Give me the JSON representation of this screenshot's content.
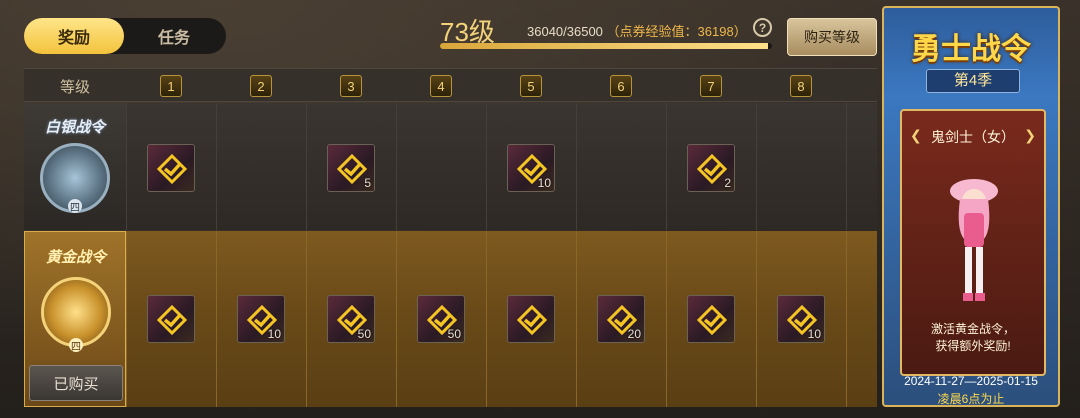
{
  "tabs": [
    {
      "label": "奖励",
      "active": true
    },
    {
      "label": "任务",
      "active": false
    }
  ],
  "header": {
    "level_label": "73级",
    "exp": "36040/36500",
    "points_label": "（点券经验值：36198）",
    "exp_progress": 0.987,
    "help_glyph": "?",
    "buy_level_label": "购买等级"
  },
  "table": {
    "level_header": "等级",
    "levels": [
      "1",
      "2",
      "3",
      "4",
      "5",
      "6",
      "7",
      "8"
    ],
    "silver": {
      "title": "白银战令",
      "emblem_num": "四",
      "rewards": [
        {
          "col": 0,
          "count": ""
        },
        {
          "col": 2,
          "count": "5"
        },
        {
          "col": 4,
          "count": "10"
        },
        {
          "col": 6,
          "count": "2"
        }
      ]
    },
    "gold": {
      "title": "黄金战令",
      "emblem_num": "四",
      "bought_label": "已购买",
      "rewards": [
        {
          "col": 0,
          "count": ""
        },
        {
          "col": 1,
          "count": "10"
        },
        {
          "col": 2,
          "count": "50"
        },
        {
          "col": 3,
          "count": "50"
        },
        {
          "col": 4,
          "count": ""
        },
        {
          "col": 5,
          "count": "20"
        },
        {
          "col": 6,
          "count": ""
        },
        {
          "col": 7,
          "count": "10"
        }
      ]
    }
  },
  "promo": {
    "title": "勇士战令",
    "season": "第4季",
    "character": "鬼剑士（女）",
    "note_line1": "激活黄金战令，",
    "note_line2": "获得额外奖励!",
    "dates": "2024-11-27—2025-01-15",
    "dates_sub": "凌晨6点为止"
  },
  "colors": {
    "accent_gold": "#f3d27a",
    "tab_active": "#f3c33b",
    "check": "#f5c623"
  },
  "icons": [
    "help-icon",
    "checkmark-icon",
    "left-arrow-icon",
    "right-arrow-icon"
  ]
}
